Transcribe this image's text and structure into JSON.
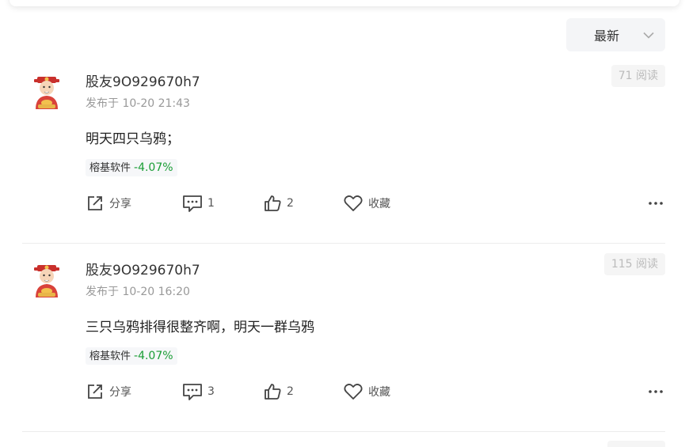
{
  "sort": {
    "label": "最新"
  },
  "posts": [
    {
      "username": "股友9O929670h7",
      "time": "发布于 10-20 21:43",
      "reads": "71 阅读",
      "content": "明天四只乌鸦；",
      "stock": {
        "name": "榕基软件",
        "change": "-4.07%"
      },
      "actions": {
        "share": "分享",
        "comments": "1",
        "likes": "2",
        "favorite": "收藏"
      }
    },
    {
      "username": "股友9O929670h7",
      "time": "发布于 10-20 16:20",
      "reads": "115 阅读",
      "content": "三只乌鸦排得很整齐啊，明天一群乌鸦",
      "stock": {
        "name": "榕基软件",
        "change": "-4.07%"
      },
      "actions": {
        "share": "分享",
        "comments": "3",
        "likes": "2",
        "favorite": "收藏"
      }
    }
  ],
  "colors": {
    "positive": "#1a9d35",
    "muted": "#999999"
  },
  "icons": [
    "chevron-down-icon",
    "share-icon",
    "comment-icon",
    "thumbs-up-icon",
    "heart-icon",
    "more-icon"
  ]
}
